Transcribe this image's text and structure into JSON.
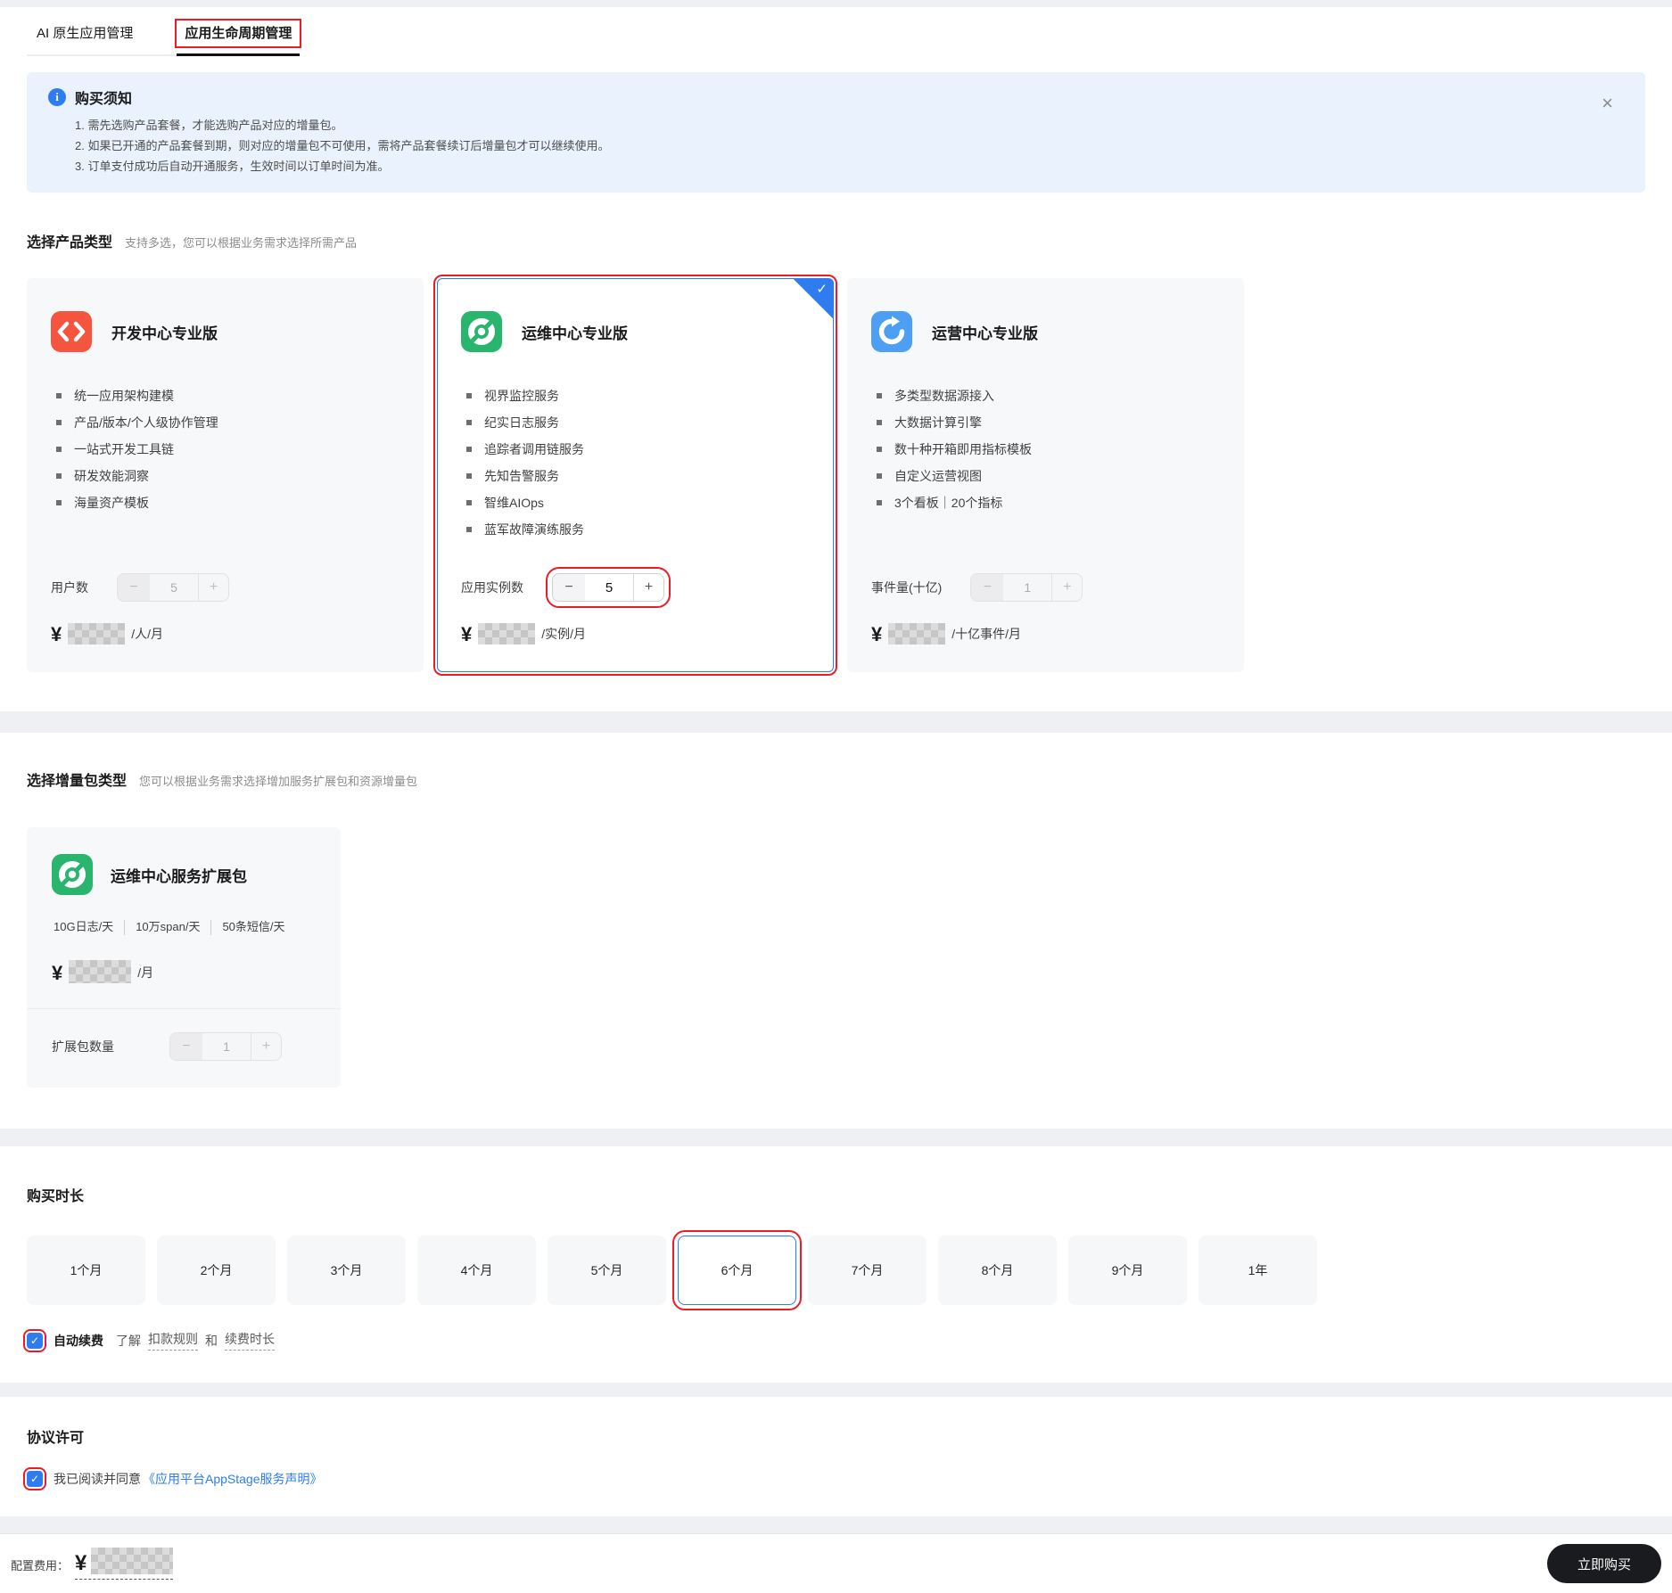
{
  "tabs": [
    {
      "label": "AI 原生应用管理",
      "active": false
    },
    {
      "label": "应用生命周期管理",
      "active": true
    }
  ],
  "notice": {
    "title": "购买须知",
    "items": [
      "1. 需先选购产品套餐，才能选购产品对应的增量包。",
      "2. 如果已开通的产品套餐到期，则对应的增量包不可使用，需将产品套餐续订后增量包才可以继续使用。",
      "3. 订单支付成功后自动开通服务，生效时间以订单时间为准。"
    ]
  },
  "product_section": {
    "title": "选择产品类型",
    "subtitle": "支持多选，您可以根据业务需求选择所需产品",
    "cards": [
      {
        "title": "开发中心专业版",
        "features": [
          "统一应用架构建模",
          "产品/版本/个人级协作管理",
          "一站式开发工具链",
          "研发效能洞察",
          "海量资产模板"
        ],
        "qty_label": "用户数",
        "qty": "5",
        "currency": "¥",
        "price_unit": "/人/月",
        "selected": false
      },
      {
        "title": "运维中心专业版",
        "features": [
          "视界监控服务",
          "纪实日志服务",
          "追踪者调用链服务",
          "先知告警服务",
          "智维AIOps",
          "蓝军故障演练服务"
        ],
        "qty_label": "应用实例数",
        "qty": "5",
        "currency": "¥",
        "price_unit": "/实例/月",
        "selected": true
      },
      {
        "title": "运营中心专业版",
        "features": [
          "多类型数据源接入",
          "大数据计算引擎",
          "数十种开箱即用指标模板",
          "自定义运营视图",
          "3个看板｜20个指标"
        ],
        "qty_label": "事件量(十亿)",
        "qty": "1",
        "currency": "¥",
        "price_unit": "/十亿事件/月",
        "selected": false
      }
    ]
  },
  "addon_section": {
    "title": "选择增量包类型",
    "subtitle": "您可以根据业务需求选择增加服务扩展包和资源增量包",
    "card": {
      "title": "运维中心服务扩展包",
      "specs": [
        "10G日志/天",
        "10万span/天",
        "50条短信/天"
      ],
      "currency": "¥",
      "price_unit": "/月",
      "qty_label": "扩展包数量",
      "qty": "1"
    }
  },
  "duration_section": {
    "title": "购买时长",
    "options": [
      "1个月",
      "2个月",
      "3个月",
      "4个月",
      "5个月",
      "6个月",
      "7个月",
      "8个月",
      "9个月",
      "1年"
    ],
    "selected_index": 5,
    "autorenew": {
      "checked": true,
      "label": "自动续费",
      "learn": "了解",
      "rules_link": "扣款规则",
      "and": "和",
      "term_link": "续费时长"
    }
  },
  "agreement_section": {
    "title": "协议许可",
    "checked": true,
    "text": "我已阅读并同意",
    "link": "《应用平台AppStage服务声明》"
  },
  "footer": {
    "fee_label": "配置费用：",
    "currency": "¥",
    "buy_label": "立即购买"
  },
  "icons": {
    "info": "i",
    "close": "×",
    "check": "✓",
    "minus": "−",
    "plus": "+"
  },
  "colors": {
    "accent": "#2e7cf0",
    "annotation": "#ed1c24",
    "dev_icon": "#f5543f",
    "om_icon": "#2ab56f",
    "ops_icon": "#4c9ff2",
    "notice_bg": "#e9f2fd"
  }
}
